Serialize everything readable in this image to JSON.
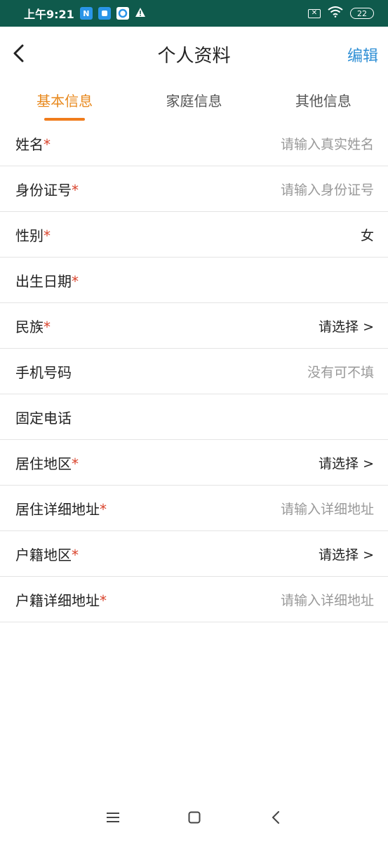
{
  "status_bar": {
    "time": "上午9:21",
    "notif_icons": [
      "N",
      "",
      ""
    ],
    "battery": "22"
  },
  "header": {
    "title": "个人资料",
    "edit_label": "编辑"
  },
  "tabs": [
    {
      "label": "基本信息",
      "active": true
    },
    {
      "label": "家庭信息",
      "active": false
    },
    {
      "label": "其他信息",
      "active": false
    }
  ],
  "form": {
    "rows": [
      {
        "label": "姓名",
        "required": true,
        "value": "请输入真实姓名",
        "kind": "placeholder"
      },
      {
        "label": "身份证号",
        "required": true,
        "value": "请输入身份证号",
        "kind": "placeholder"
      },
      {
        "label": "性别",
        "required": true,
        "value": "女",
        "kind": "value"
      },
      {
        "label": "出生日期",
        "required": true,
        "value": "",
        "kind": "value"
      },
      {
        "label": "民族",
        "required": true,
        "value": "请选择 >",
        "kind": "select"
      },
      {
        "label": "手机号码",
        "required": false,
        "value": "没有可不填",
        "kind": "placeholder"
      },
      {
        "label": "固定电话",
        "required": false,
        "value": "",
        "kind": "value"
      },
      {
        "label": "居住地区",
        "required": true,
        "value": "请选择 >",
        "kind": "select"
      },
      {
        "label": "居住详细地址",
        "required": true,
        "value": "请输入详细地址",
        "kind": "placeholder"
      },
      {
        "label": "户籍地区",
        "required": true,
        "value": "请选择 >",
        "kind": "select"
      },
      {
        "label": "户籍详细地址",
        "required": true,
        "value": "请输入详细地址",
        "kind": "placeholder"
      }
    ],
    "required_mark": "*"
  },
  "colors": {
    "status_bar": "#0f5a4c",
    "accent_tab": "#e8891e",
    "edit": "#2f8fd5",
    "required": "#d9432c"
  }
}
